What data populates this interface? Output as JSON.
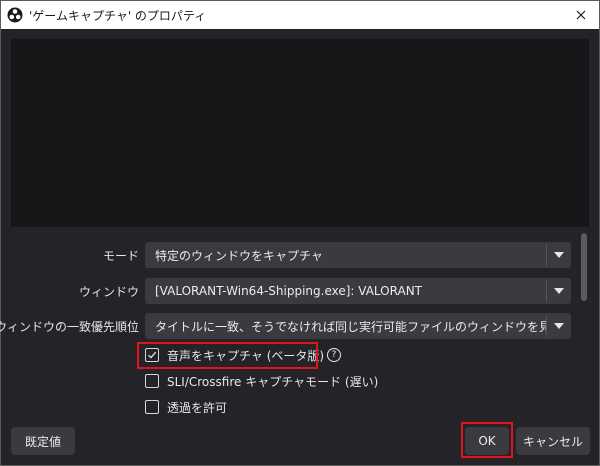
{
  "window": {
    "title": "'ゲームキャプチャ' のプロパティ",
    "app_icon": "obs-icon",
    "close_icon": "close-icon"
  },
  "properties": {
    "mode": {
      "label": "モード",
      "value": "特定のウィンドウをキャプチャ"
    },
    "window": {
      "label": "ウィンドウ",
      "value": "[VALORANT-Win64-Shipping.exe]: VALORANT"
    },
    "priority": {
      "label": "ウィンドウの一致優先順位",
      "value": "タイトルに一致、そうでなければ同じ実行可能ファイルのウィンドウを見つける"
    },
    "checkboxes": [
      {
        "label": "音声をキャプチャ (ベータ版)",
        "checked": true,
        "help_icon": "help-icon"
      },
      {
        "label": "SLI/Crossfire キャプチャモード (遅い)",
        "checked": false
      },
      {
        "label": "透過を許可",
        "checked": false
      }
    ]
  },
  "buttons": {
    "defaults": "既定値",
    "ok": "OK",
    "cancel": "キャンセル"
  },
  "colors": {
    "highlight_box": "#e2141b",
    "background": "#232328",
    "control": "#3a3a3f"
  }
}
